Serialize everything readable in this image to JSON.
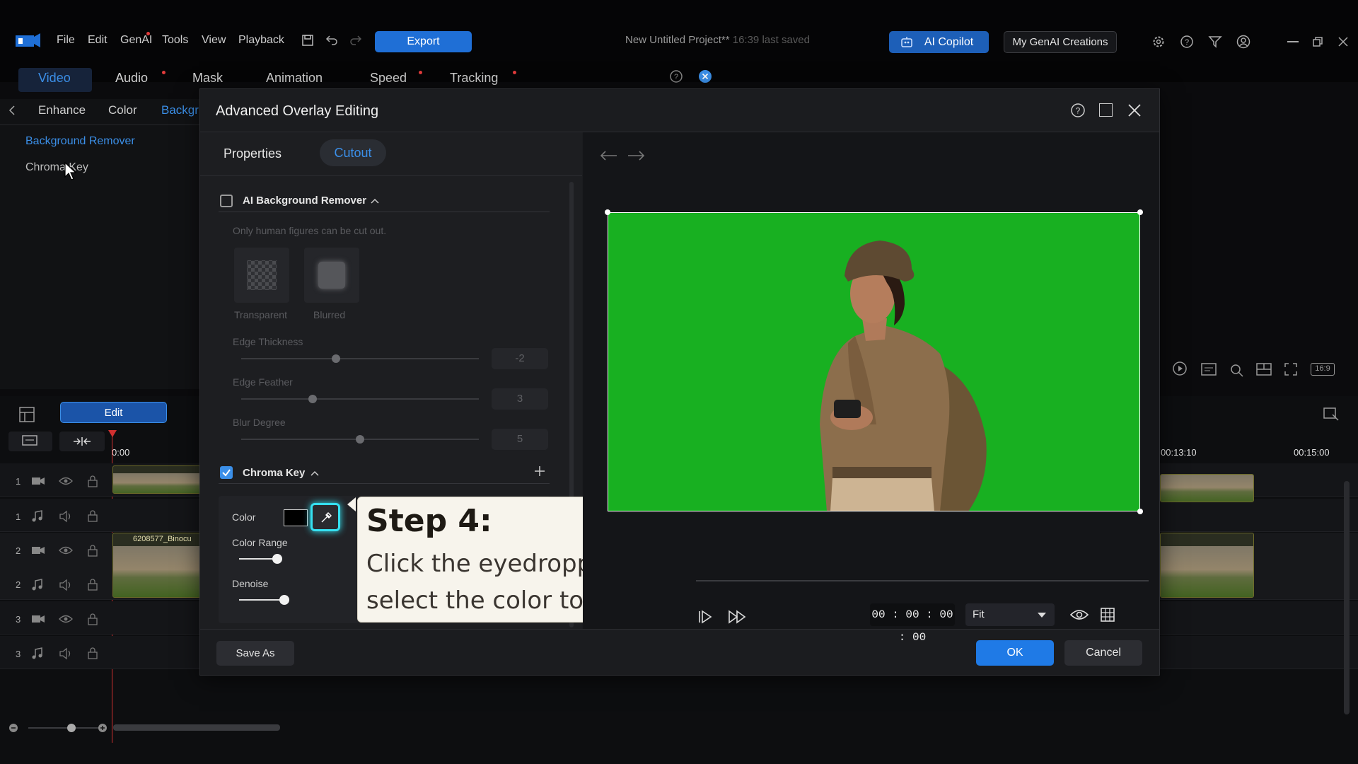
{
  "menubar": {
    "items": [
      "File",
      "Edit",
      "GenAI",
      "Tools",
      "View",
      "Playback"
    ],
    "export_label": "Export",
    "project_title": "New Untitled Project**",
    "last_saved": "16:39 last saved",
    "ai_copilot_label": "AI Copilot",
    "my_genai_label": "My GenAI Creations"
  },
  "main_tabs": [
    "Video",
    "Audio",
    "Mask",
    "Animation",
    "Speed",
    "Tracking"
  ],
  "sub_tabs": [
    "Enhance",
    "Color",
    "Backgr"
  ],
  "left_panel": {
    "items": [
      "Background Remover",
      "Chroma Key"
    ]
  },
  "timeline": {
    "edit_label": "Edit",
    "time_start": "0:00",
    "time_mid": "00:13:10",
    "time_end": "00:15:00",
    "track_numbers": [
      "1",
      "1",
      "2",
      "2",
      "3",
      "3"
    ],
    "clip1_label": "6208577_Binocu",
    "clip0_label": "6208577_Binocu"
  },
  "dialog": {
    "title": "Advanced Overlay Editing",
    "tabs": {
      "properties": "Properties",
      "cutout": "Cutout"
    },
    "ai_bg": {
      "label": "AI Background Remover",
      "note": "Only human figures can be cut out.",
      "transparent_label": "Transparent",
      "blurred_label": "Blurred",
      "edge_thickness_label": "Edge Thickness",
      "edge_thickness_value": "-2",
      "edge_thickness_level": 0.4,
      "edge_feather_label": "Edge Feather",
      "edge_feather_value": "3",
      "edge_feather_level": 0.3,
      "blur_degree_label": "Blur Degree",
      "blur_degree_value": "5",
      "blur_degree_level": 0.5
    },
    "chroma": {
      "label": "Chroma Key",
      "color_label": "Color",
      "color_range_label": "Color Range",
      "denoise_label": "Denoise"
    },
    "callout": {
      "heading": "Step 4:",
      "body": "Click the eyedropper and select the color to remove."
    },
    "timecode": "00 : 00 : 00 : 00",
    "fit_label": "Fit",
    "save_as_label": "Save As",
    "ok_label": "OK",
    "cancel_label": "Cancel"
  },
  "preview_aspect": "16:9"
}
